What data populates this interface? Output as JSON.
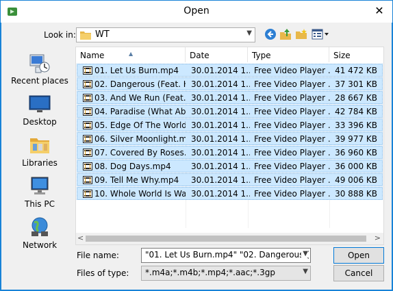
{
  "window": {
    "title": "Open",
    "close_glyph": "✕"
  },
  "toolbar": {
    "look_in_label": "Look in:",
    "look_in_value": "WT",
    "back_icon": "back-arrow-icon",
    "up_icon": "up-folder-icon",
    "new_folder_icon": "new-folder-icon",
    "views_icon": "view-menu-icon"
  },
  "places": [
    {
      "label": "Recent places",
      "icon": "recent-places-icon"
    },
    {
      "label": "Desktop",
      "icon": "desktop-icon"
    },
    {
      "label": "Libraries",
      "icon": "libraries-icon"
    },
    {
      "label": "This PC",
      "icon": "this-pc-icon"
    },
    {
      "label": "Network",
      "icon": "network-icon"
    }
  ],
  "columns": [
    "Name",
    "Date",
    "Type",
    "Size"
  ],
  "files": [
    {
      "name": "01. Let Us Burn.mp4",
      "date": "30.01.2014 1...",
      "type": "Free Video Player ...",
      "size": "41 472 KB"
    },
    {
      "name": "02. Dangerous (Feat. H...",
      "date": "30.01.2014 1...",
      "type": "Free Video Player ...",
      "size": "37 301 KB"
    },
    {
      "name": "03. And We Run (Feat. ...",
      "date": "30.01.2014 1...",
      "type": "Free Video Player ...",
      "size": "28 667 KB"
    },
    {
      "name": "04. Paradise (What Ab...",
      "date": "30.01.2014 1...",
      "type": "Free Video Player ...",
      "size": "42 784 KB"
    },
    {
      "name": "05. Edge Of The World....",
      "date": "30.01.2014 1...",
      "type": "Free Video Player ...",
      "size": "33 396 KB"
    },
    {
      "name": "06. Silver Moonlight.m...",
      "date": "30.01.2014 1...",
      "type": "Free Video Player ...",
      "size": "39 977 KB"
    },
    {
      "name": "07. Covered By Roses....",
      "date": "30.01.2014 1...",
      "type": "Free Video Player ...",
      "size": "36 960 KB"
    },
    {
      "name": "08. Dog Days.mp4",
      "date": "30.01.2014 1...",
      "type": "Free Video Player ...",
      "size": "36 000 KB"
    },
    {
      "name": "09. Tell Me Why.mp4",
      "date": "30.01.2014 1...",
      "type": "Free Video Player ...",
      "size": "49 006 KB"
    },
    {
      "name": "10. Whole World Is Wa...",
      "date": "30.01.2014 1...",
      "type": "Free Video Player ...",
      "size": "30 888 KB"
    }
  ],
  "file_name": {
    "label": "File name:",
    "value": "\"01. Let Us Burn.mp4\" \"02. Dangerous (Feat. H"
  },
  "file_type": {
    "label": "Files of type:",
    "value": "*.m4a;*.m4b;*.mp4;*.aac;*.3gp"
  },
  "buttons": {
    "open": "Open",
    "cancel": "Cancel"
  },
  "colors": {
    "accent": "#1883d7",
    "selection": "#cce8ff"
  }
}
